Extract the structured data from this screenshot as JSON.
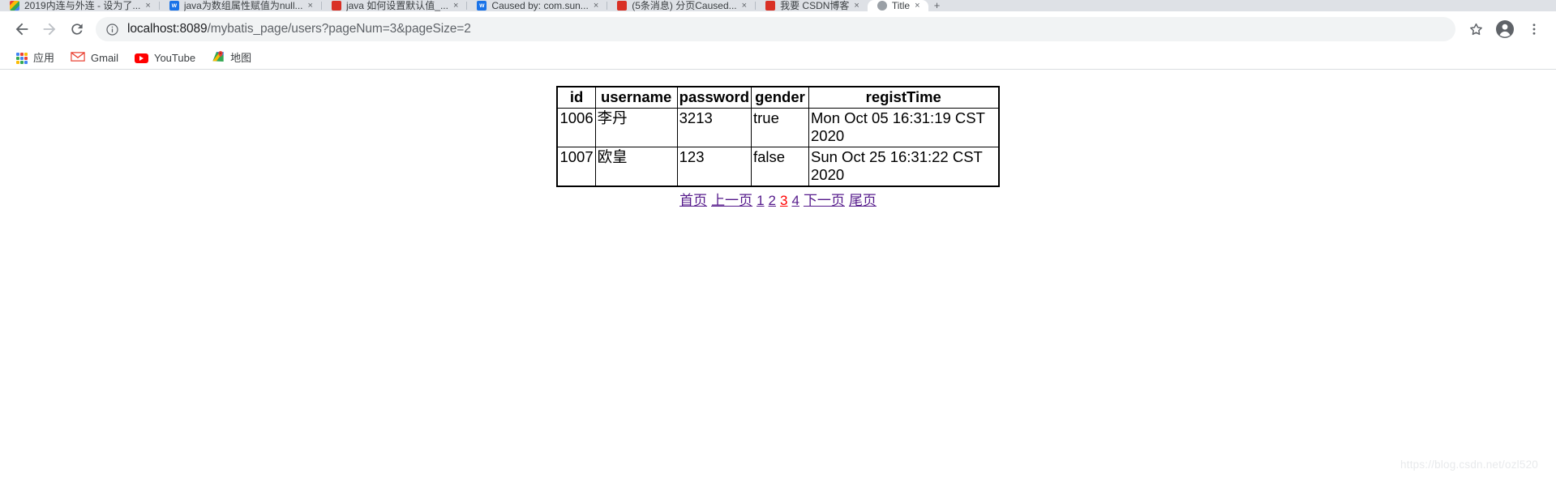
{
  "browser": {
    "tabs": [
      {
        "title": "2019内连与外连 - 设为了...",
        "favicon": "colorful-icon",
        "close_label": "×",
        "active": false
      },
      {
        "title": "java为数组属性赋值为null...",
        "favicon": "blue-doc-icon",
        "close_label": "×",
        "active": false
      },
      {
        "title": "java 如何设置默认值_...",
        "favicon": "red-pdf-icon",
        "close_label": "×",
        "active": false
      },
      {
        "title": "Caused by: com.sun...",
        "favicon": "red-pdf-icon",
        "close_label": "×",
        "active": false
      },
      {
        "title": "(5条消息) 分页Caused...",
        "favicon": "red-pdf-icon",
        "close_label": "×",
        "active": false
      },
      {
        "title": "我要 CSDN博客",
        "favicon": "red-pdf-icon",
        "close_label": "×",
        "active": false
      },
      {
        "title": "Title",
        "favicon": "grey-globe-icon",
        "close_label": "×",
        "active": true
      }
    ],
    "new_tab_label": "+",
    "toolbar": {
      "back_label": "Back",
      "forward_label": "Forward",
      "reload_label": "Reload",
      "site_info_label": "View site information",
      "url_scheme_host": "localhost:8089",
      "url_path": "/mybatis_page/users?pageNum=3&pageSize=2",
      "url_full": "localhost:8089/mybatis_page/users?pageNum=3&pageSize=2",
      "bookmark_label": "Bookmark this tab",
      "profile_label": "Profile",
      "menu_label": "Customize and control Google Chrome"
    },
    "bookmarks": [
      {
        "label": "应用",
        "icon": "apps-grid-icon"
      },
      {
        "label": "Gmail",
        "icon": "gmail-icon"
      },
      {
        "label": "YouTube",
        "icon": "youtube-icon"
      },
      {
        "label": "地图",
        "icon": "google-maps-icon"
      }
    ]
  },
  "page": {
    "table": {
      "headers": [
        "id",
        "username",
        "password",
        "gender",
        "registTime"
      ],
      "rows": [
        {
          "id": "1006",
          "username": "李丹",
          "password": "3213",
          "gender": "true",
          "registTime": "Mon Oct 05 16:31:19 CST 2020"
        },
        {
          "id": "1007",
          "username": "欧皇",
          "password": "123",
          "gender": "false",
          "registTime": "Sun Oct 25 16:31:22 CST 2020"
        }
      ]
    },
    "pagination": {
      "first_label": "首页",
      "prev_label": "上一页",
      "pages": [
        "1",
        "2",
        "3",
        "4"
      ],
      "current_page": "3",
      "next_label": "下一页",
      "last_label": "尾页"
    },
    "watermark": "https://blog.csdn.net/ozl520"
  },
  "colors": {
    "link": "#551a8b",
    "current_page": "#ff0000",
    "chrome_tabstrip": "#dee1e6",
    "omnibox_bg": "#f1f3f4",
    "text": "#202124"
  }
}
